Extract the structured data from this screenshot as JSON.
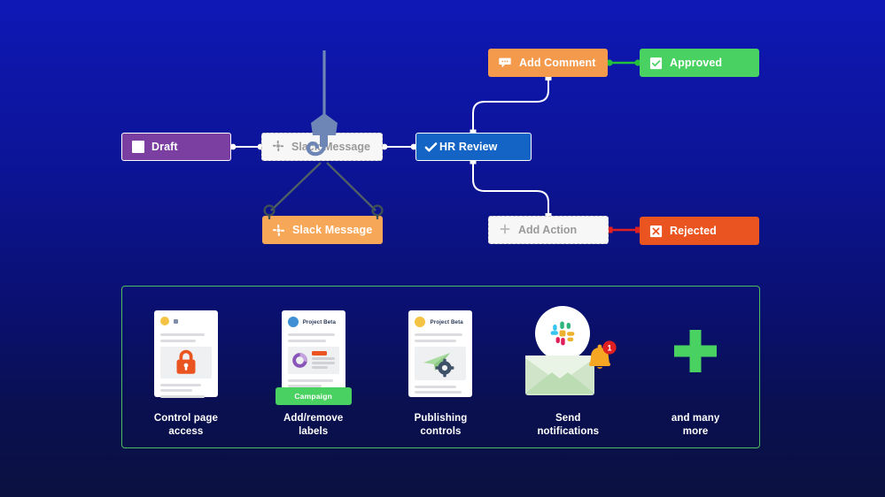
{
  "flow": {
    "nodes": [
      {
        "id": "draft",
        "label": "Draft",
        "icon": "white-square-icon",
        "color": "#7a3fa0"
      },
      {
        "id": "slack-ghost",
        "label": "Slack Message",
        "icon": "slack-icon",
        "color": "#f7f7f7",
        "state": "placeholder"
      },
      {
        "id": "hr-review",
        "label": "HR Review",
        "icon": "check-icon",
        "color": "#1364c4"
      },
      {
        "id": "add-comment",
        "label": "Add Comment",
        "icon": "comment-icon",
        "color": "#f49a4c"
      },
      {
        "id": "approved",
        "label": "Approved",
        "icon": "checkbox-checked-icon",
        "color": "#49d261"
      },
      {
        "id": "add-action",
        "label": "Add Action",
        "icon": "plus-icon",
        "color": "#f7f7f7",
        "state": "placeholder"
      },
      {
        "id": "rejected",
        "label": "Rejected",
        "icon": "x-box-icon",
        "color": "#ea5420"
      },
      {
        "id": "slack-orange",
        "label": "Slack Message",
        "icon": "slack-icon",
        "color": "#f7a758"
      }
    ],
    "connector_colors": {
      "default": "#ffffff",
      "approved": "#22c03c",
      "rejected": "#e02020",
      "crane_cable": "#4f5f66"
    },
    "crane": {
      "name": "crane-hook",
      "hook_color": "#6e86b5"
    }
  },
  "features": {
    "border_color": "#4dbd5f",
    "items": [
      {
        "id": "control-page-access",
        "caption": "Control page\naccess",
        "art": "locked-document",
        "doc": {
          "dot_color": "#f5c344",
          "lock_color": "#ea5420"
        }
      },
      {
        "id": "add-remove-labels",
        "caption": "Add/remove\nlabels",
        "art": "document-with-label",
        "doc": {
          "title": "Project Beta",
          "avatar_color": "#3f8fd4",
          "donut_color": "#8a55b8",
          "bar_color": "#ea5420"
        },
        "tag": {
          "label": "Campaign",
          "color": "#49d261"
        }
      },
      {
        "id": "publishing-controls",
        "caption": "Publishing\ncontrols",
        "art": "document-with-gear",
        "doc": {
          "title": "Project Beta",
          "avatar_color": "#f5c344",
          "plane_color": "#a9dba0",
          "gear_color": "#3e5168"
        }
      },
      {
        "id": "send-notifications",
        "caption": "Send\nnotifications",
        "art": "slack-envelope-bell",
        "badge": "1",
        "colors": {
          "envelope": "#bcdcb4",
          "bell": "#f5a623",
          "badge": "#e02020"
        }
      },
      {
        "id": "and-many-more",
        "caption": "and many\nmore",
        "art": "plus-sign",
        "colors": {
          "plus": "#49d261"
        }
      }
    ]
  }
}
